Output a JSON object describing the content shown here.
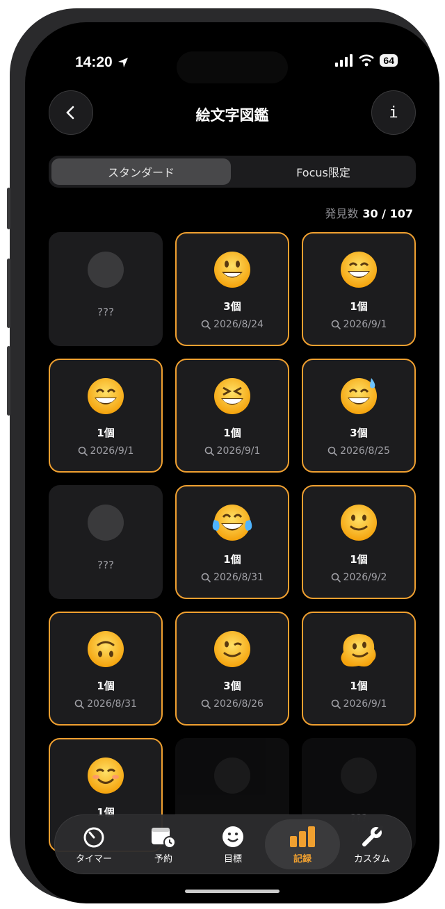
{
  "status": {
    "time": "14:20",
    "battery": "64"
  },
  "header": {
    "title": "絵文字図鑑",
    "back_icon": "chevron-left-icon",
    "info_label": "i"
  },
  "segments": [
    {
      "label": "スタンダード",
      "active": true
    },
    {
      "label": "Focus限定",
      "active": false
    }
  ],
  "discovered": {
    "label": "発見数",
    "value": "30 / 107"
  },
  "cards": [
    {
      "found": false,
      "label": "???"
    },
    {
      "found": true,
      "emoji": "smiley",
      "count": "3個",
      "date": "2026/8/24"
    },
    {
      "found": true,
      "emoji": "grin",
      "count": "1個",
      "date": "2026/9/1"
    },
    {
      "found": true,
      "emoji": "grin",
      "count": "1個",
      "date": "2026/9/1"
    },
    {
      "found": true,
      "emoji": "laughing",
      "count": "1個",
      "date": "2026/9/1"
    },
    {
      "found": true,
      "emoji": "sweat-smile",
      "count": "3個",
      "date": "2026/8/25"
    },
    {
      "found": false,
      "label": "???"
    },
    {
      "found": true,
      "emoji": "joy",
      "count": "1個",
      "date": "2026/8/31"
    },
    {
      "found": true,
      "emoji": "slight-smile",
      "count": "1個",
      "date": "2026/9/2"
    },
    {
      "found": true,
      "emoji": "upside-down",
      "count": "1個",
      "date": "2026/8/31"
    },
    {
      "found": true,
      "emoji": "wink",
      "count": "3個",
      "date": "2026/8/26"
    },
    {
      "found": true,
      "emoji": "melting",
      "count": "1個",
      "date": "2026/9/1"
    },
    {
      "found": true,
      "emoji": "blush",
      "count": "1個",
      "date": ""
    },
    {
      "found": false,
      "label": ""
    },
    {
      "found": false,
      "label": "???"
    }
  ],
  "tabs": [
    {
      "label": "タイマー",
      "icon": "timer-icon"
    },
    {
      "label": "予約",
      "icon": "calendar-clock-icon"
    },
    {
      "label": "目標",
      "icon": "smiley-icon"
    },
    {
      "label": "記録",
      "icon": "bar-chart-icon",
      "active": true
    },
    {
      "label": "カスタム",
      "icon": "wrench-icon"
    }
  ],
  "colors": {
    "accent": "#f0a030",
    "card": "#1c1c1e",
    "background": "#000000"
  }
}
